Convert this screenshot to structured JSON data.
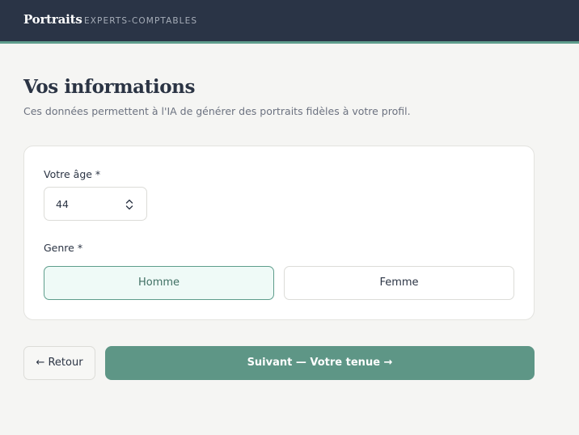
{
  "header": {
    "brand": "Portraits",
    "subtitle": "EXPERTS-COMPTABLES"
  },
  "page": {
    "title": "Vos informations",
    "subtitle": "Ces données permettent à l'IA de générer des portraits fidèles à votre profil."
  },
  "form": {
    "age_label": "Votre âge *",
    "age_value": "44",
    "genre_label": "Genre *",
    "genre_options": [
      {
        "label": "Homme",
        "selected": true
      },
      {
        "label": "Femme",
        "selected": false
      }
    ]
  },
  "actions": {
    "back_label": "← Retour",
    "next_label": "Suivant — Votre tenue →"
  },
  "colors": {
    "header_bg": "#2a3446",
    "accent": "#5e9686",
    "selected_bg": "#effaf7"
  }
}
